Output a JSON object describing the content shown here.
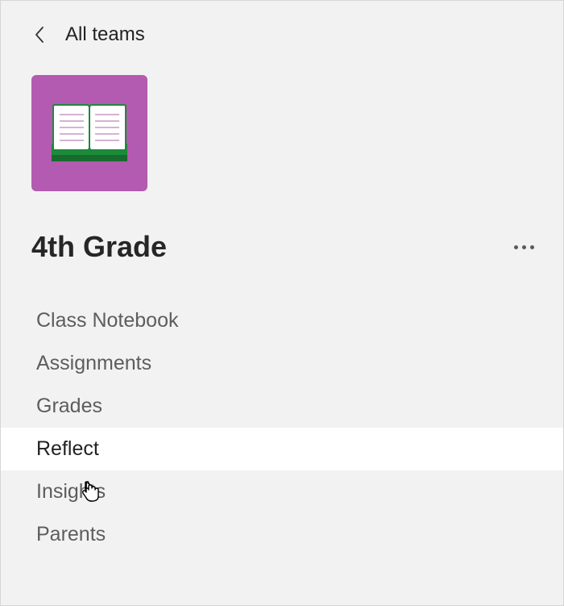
{
  "back": {
    "label": "All teams"
  },
  "team": {
    "name": "4th Grade",
    "tile_color": "#b35bb0"
  },
  "channels": [
    {
      "label": "Class Notebook",
      "selected": false
    },
    {
      "label": "Assignments",
      "selected": false
    },
    {
      "label": "Grades",
      "selected": false
    },
    {
      "label": "Reflect",
      "selected": true
    },
    {
      "label": "Insights",
      "selected": false
    },
    {
      "label": "Parents",
      "selected": false
    }
  ]
}
